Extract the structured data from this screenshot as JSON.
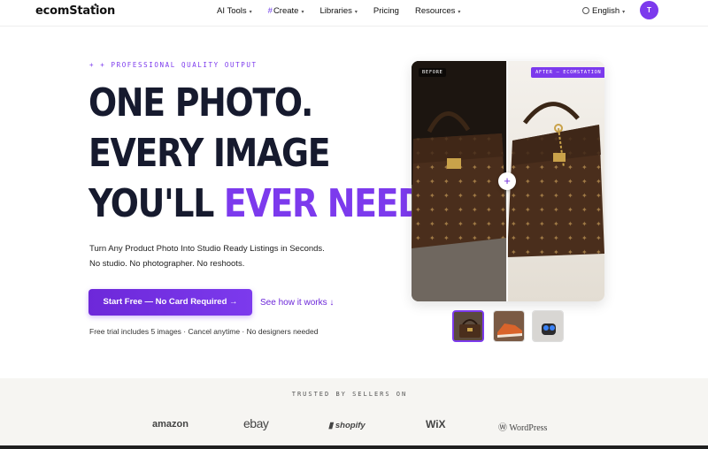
{
  "nav": {
    "logo": "ecomStation",
    "items": [
      {
        "label": "AI Tools",
        "has_caret": true
      },
      {
        "label": "Create",
        "has_caret": true,
        "prefix": "#"
      },
      {
        "label": "Libraries",
        "has_caret": true
      },
      {
        "label": "Pricing",
        "has_caret": false
      },
      {
        "label": "Resources",
        "has_caret": true
      }
    ],
    "language": "English",
    "avatar_initial": "T"
  },
  "hero": {
    "eyebrow": "+ + PROFESSIONAL QUALITY OUTPUT",
    "headline_line1": "ONE PHOTO.",
    "headline_line2": "EVERY IMAGE",
    "headline_line3_plain": "YOU'LL ",
    "headline_line3_accent": "EVER NEED.",
    "subtitle_1": "Turn Any Product Photo Into Studio Ready Listings in Seconds.",
    "subtitle_2": "No studio. No photographer. No reshoots.",
    "cta_label": "Start Free — No Card Required →",
    "secondary_link": "See how it works ↓",
    "fineprint": "Free trial includes 5 images · Cancel anytime · No designers needed"
  },
  "compare": {
    "before_label": "BEFORE",
    "after_label": "AFTER — ECOMSTATION",
    "handle_icon": "plus"
  },
  "thumbnails": [
    {
      "name": "handbag",
      "active": true
    },
    {
      "name": "sneaker",
      "active": false
    },
    {
      "name": "earbuds",
      "active": false
    }
  ],
  "trusted": {
    "label": "TRUSTED BY SELLERS ON",
    "brands": [
      "amazon",
      "ebay",
      "shopify",
      "WiX",
      "WordPress"
    ]
  },
  "colors": {
    "accent": "#7c3aed",
    "headline": "#161a2e",
    "trusted_bg": "#f6f5f2"
  }
}
